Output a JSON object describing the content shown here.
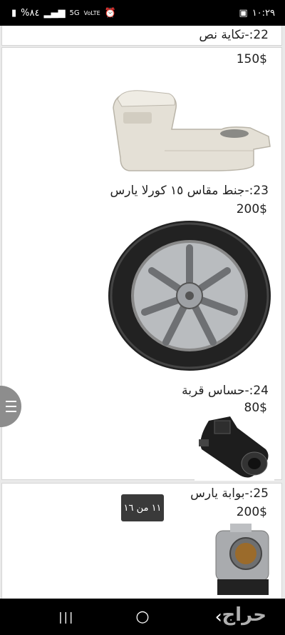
{
  "status_bar": {
    "time": "١٠:٢٩",
    "battery": "%٨٤",
    "network": "5G",
    "volte": "VoLTE"
  },
  "listing": [
    {
      "number_title": "22:-تكاية نص",
      "price": "150$"
    },
    {
      "number_title": "23:-جنط مقاس ١٥ كورلا يارس",
      "price": "200$"
    },
    {
      "number_title": "24:-حساس قربة",
      "price": "80$"
    },
    {
      "number_title": "25:-بوابة يارس",
      "price": "200$"
    }
  ],
  "page_indicator": "١١ من ١٦",
  "watermark": "حراج",
  "nav": {
    "recents": "|||",
    "home": "○",
    "back": "‹"
  }
}
